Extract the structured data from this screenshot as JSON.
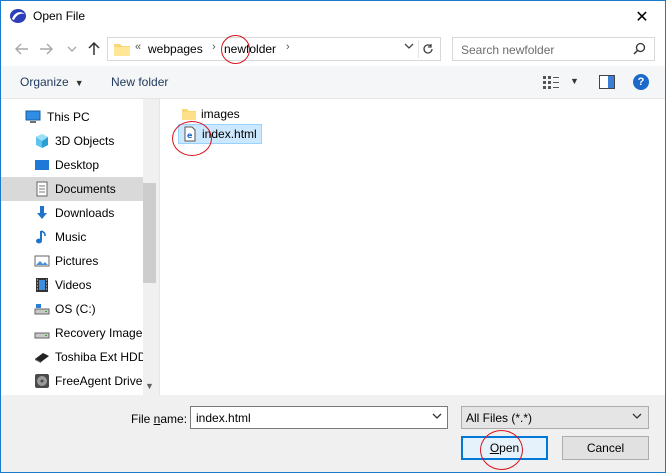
{
  "window": {
    "title": "Open File",
    "close_glyph": "✕",
    "app_icon": "app-logo-icon"
  },
  "address_bar": {
    "overflow": "«",
    "crumbs": [
      "webpages",
      "newfolder"
    ],
    "separator": "›",
    "placeholder_search": "Search newfolder"
  },
  "toolbar": {
    "organize": "Organize",
    "new_folder": "New folder",
    "help": "?"
  },
  "nav_pane": {
    "items": [
      {
        "label": "This PC",
        "icon": "computer-icon"
      },
      {
        "label": "3D Objects",
        "icon": "cube-icon"
      },
      {
        "label": "Desktop",
        "icon": "desktop-icon"
      },
      {
        "label": "Documents",
        "icon": "documents-icon",
        "selected": true
      },
      {
        "label": "Downloads",
        "icon": "download-arrow-icon"
      },
      {
        "label": "Music",
        "icon": "music-note-icon"
      },
      {
        "label": "Pictures",
        "icon": "pictures-icon"
      },
      {
        "label": "Videos",
        "icon": "film-icon"
      },
      {
        "label": "OS (C:)",
        "icon": "drive-icon"
      },
      {
        "label": "Recovery Image",
        "icon": "drive-icon"
      },
      {
        "label": "Toshiba Ext HDD",
        "icon": "external-drive-icon"
      },
      {
        "label": "FreeAgent Drive",
        "icon": "hdd-icon"
      }
    ]
  },
  "files": [
    {
      "name": "images",
      "icon": "folder-icon"
    },
    {
      "name": "index.html",
      "icon": "html-file-icon",
      "selected": true
    }
  ],
  "bottom": {
    "file_name_label_pre": "File ",
    "file_name_label_u": "n",
    "file_name_label_post": "ame:",
    "file_name_value": "index.html",
    "file_type": "All Files (*.*)",
    "open_u": "O",
    "open_rest": "pen",
    "cancel": "Cancel"
  },
  "colors": {
    "accent": "#0078d7",
    "annotation": "#d8141c",
    "selection": "#cce8ff"
  }
}
